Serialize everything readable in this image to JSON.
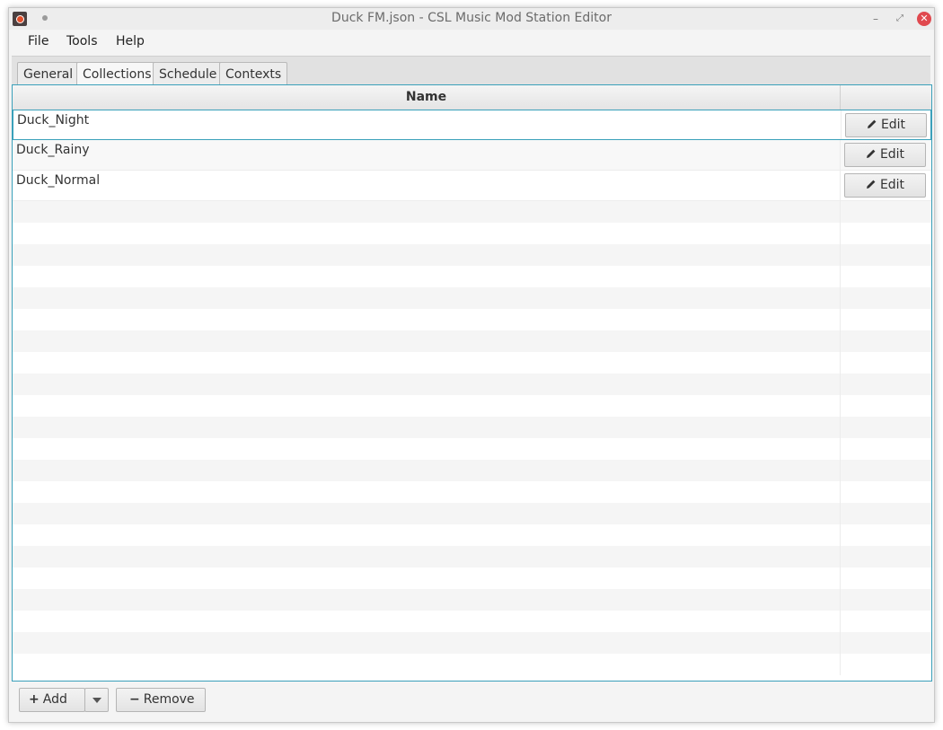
{
  "window": {
    "title": "Duck FM.json - CSL Music Mod Station Editor"
  },
  "menu": [
    "File",
    "Tools",
    "Help"
  ],
  "tabs": [
    {
      "label": "General",
      "active": false
    },
    {
      "label": "Collections",
      "active": true
    },
    {
      "label": "Schedule",
      "active": false
    },
    {
      "label": "Contexts",
      "active": false
    }
  ],
  "table": {
    "columns": [
      "Name",
      ""
    ],
    "rows": [
      {
        "name": "Duck_Night",
        "action": "Edit",
        "selected": true
      },
      {
        "name": "Duck_Rainy",
        "action": "Edit",
        "selected": false
      },
      {
        "name": "Duck_Normal",
        "action": "Edit",
        "selected": false
      }
    ]
  },
  "buttons": {
    "add": "Add",
    "remove": "Remove"
  },
  "icons": {
    "app": "radio-icon",
    "edit": "pencil-icon",
    "add": "plus-icon",
    "remove": "minus-icon",
    "dropdown": "caret-down-icon"
  },
  "colors": {
    "accent": "#3aa0ba",
    "close": "#e0494f"
  }
}
